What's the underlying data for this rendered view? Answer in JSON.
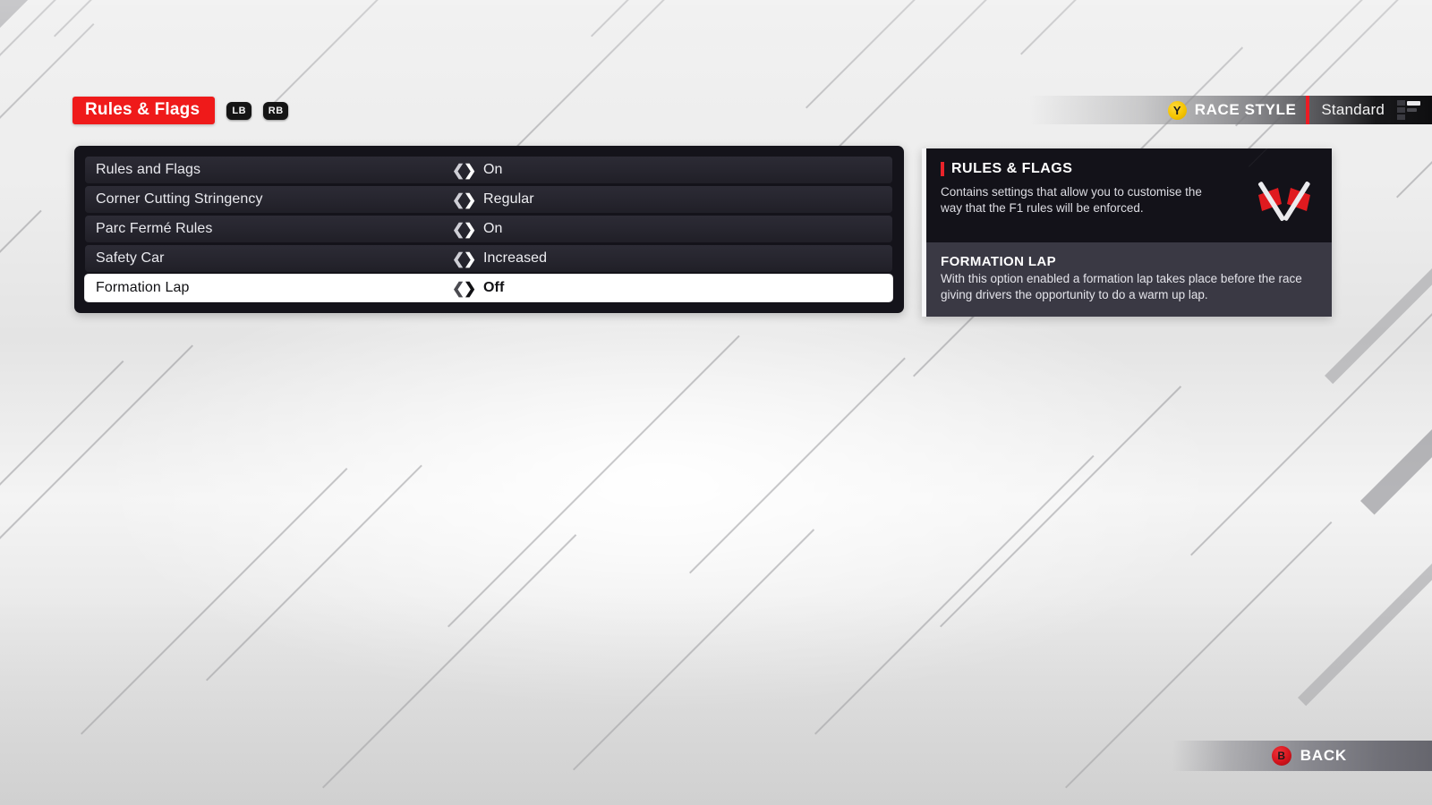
{
  "header": {
    "tab_label": "Rules & Flags",
    "left_bumper": "LB",
    "right_bumper": "RB"
  },
  "race_style": {
    "button_glyph": "Y",
    "label": "RACE STYLE",
    "value": "Standard",
    "icon": "difficulty-list-icon"
  },
  "settings": {
    "rows": [
      {
        "label": "Rules and Flags",
        "value": "On",
        "left_arrow": "❮",
        "right_arrow": "❯",
        "selected": false
      },
      {
        "label": "Corner Cutting Stringency",
        "value": "Regular",
        "left_arrow": "❮",
        "right_arrow": "❯",
        "selected": false
      },
      {
        "label": "Parc Fermé Rules",
        "value": "On",
        "left_arrow": "❮",
        "right_arrow": "❯",
        "selected": false
      },
      {
        "label": "Safety Car",
        "value": "Increased",
        "left_arrow": "❮",
        "right_arrow": "❯",
        "selected": false
      },
      {
        "label": "Formation Lap",
        "value": "Off",
        "left_arrow": "❮",
        "right_arrow": "❯",
        "selected": true
      }
    ]
  },
  "info_panel": {
    "category_title": "RULES & FLAGS",
    "category_description": "Contains settings that allow you to customise the way that the F1 rules will be enforced.",
    "icon": "crossed-flags-icon",
    "item_title": "FORMATION LAP",
    "item_description": "With this option enabled a formation lap takes place before the race giving drivers the opportunity to do a warm up lap."
  },
  "footer": {
    "back_glyph": "B",
    "back_label": "BACK"
  },
  "colors": {
    "accent_red": "#ef1a1a",
    "panel_dark": "#14131a",
    "info_dark": "#131219",
    "info_light": "#3a3944",
    "selected_row": "#ffffff",
    "button_yellow": "#f5c400",
    "button_red": "#d4141c"
  }
}
